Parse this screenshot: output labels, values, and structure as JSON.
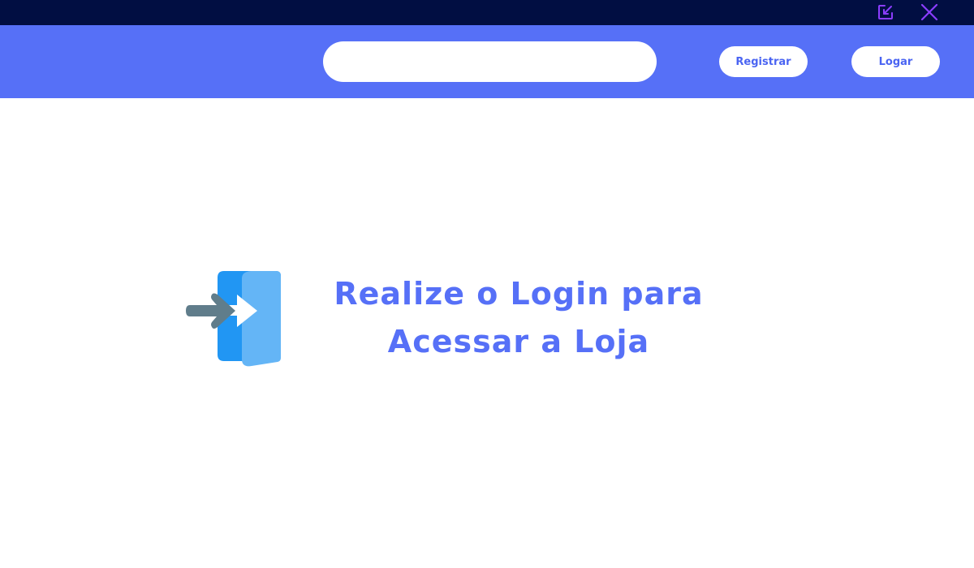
{
  "titlebar": {
    "buttons": [
      {
        "icon": "minimize-icon"
      },
      {
        "icon": "close-icon"
      }
    ],
    "colors": {
      "background": "#010e42",
      "icon_accent": "#8b3dff"
    }
  },
  "header": {
    "search": {
      "value": "",
      "placeholder": ""
    },
    "register_label": "Registrar",
    "login_label": "Logar",
    "colors": {
      "background": "#5670f7",
      "button_text": "#4a64f2"
    }
  },
  "main": {
    "icon": "login-door-icon",
    "message_line1": "Realize o Login para",
    "message_line2": "Acessar a Loja",
    "colors": {
      "message": "#5670f7",
      "door_dark": "#2196f3",
      "door_light": "#64b5f6",
      "arrow": "#607d8b"
    }
  }
}
